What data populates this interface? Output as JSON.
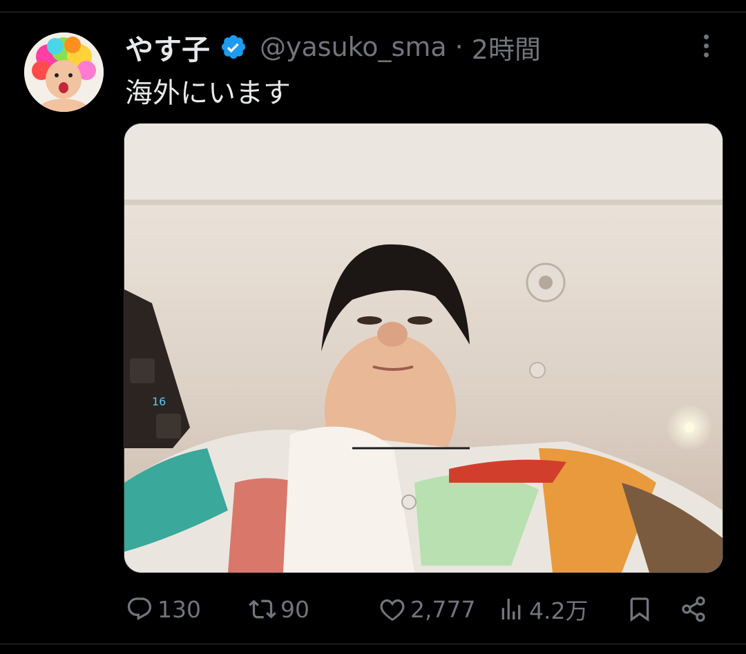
{
  "tweet": {
    "author_name": "やす子",
    "verified": true,
    "handle": "@yasuko_sma",
    "separator": "·",
    "time": "2時間",
    "text": "海外にいます",
    "media_icon": "selfie-photo"
  },
  "actions": {
    "reply_count": "130",
    "retweet_count": "90",
    "like_count": "2,777",
    "views_count": "4.2万"
  },
  "colors": {
    "background": "#000000",
    "text": "#e7e9ea",
    "secondary": "#71767b",
    "verified_blue": "#1d9bf0",
    "divider": "#2f3336"
  },
  "icons": [
    "more-icon",
    "verified-badge-icon",
    "reply-icon",
    "retweet-icon",
    "like-icon",
    "views-icon",
    "bookmark-icon",
    "share-icon"
  ]
}
